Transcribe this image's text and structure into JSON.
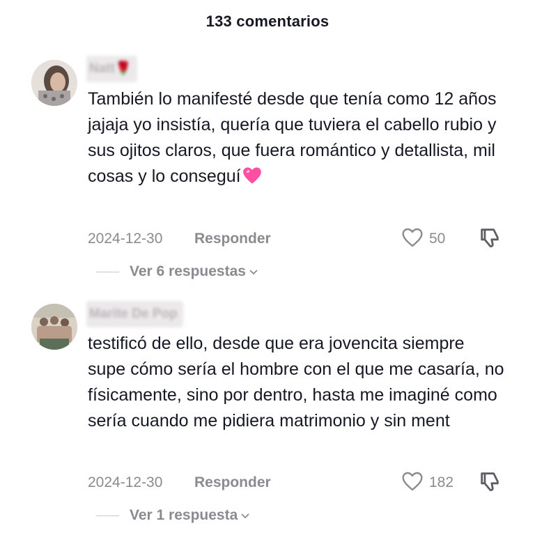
{
  "header": {
    "title": "133 comentarios"
  },
  "comments": [
    {
      "username": "Natt🌹",
      "text": "También lo manifesté desde que tenía como 12 años jajaja yo insistía, quería que tuviera el cabello rubio y sus ojitos claros, que fuera romántico y detallista, mil cosas y lo conseguí",
      "emoji": "pink-heart-icon",
      "date": "2024-12-30",
      "reply_label": "Responder",
      "likes": "50",
      "replies_label": "Ver 6 respuestas"
    },
    {
      "username": "Marite De Pop",
      "text": "testificó de ello, desde que era jovencita siempre supe cómo sería el hombre con el que me casaría, no físicamente, sino por dentro, hasta me imaginé como sería cuando me pidiera matrimonio y sin ment",
      "date": "2024-12-30",
      "reply_label": "Responder",
      "likes": "182",
      "replies_label": "Ver 1 respuesta"
    }
  ],
  "colors": {
    "text_primary": "#161823",
    "text_secondary": "#8a8b91",
    "emoji_heart": "#ff4fa3"
  }
}
